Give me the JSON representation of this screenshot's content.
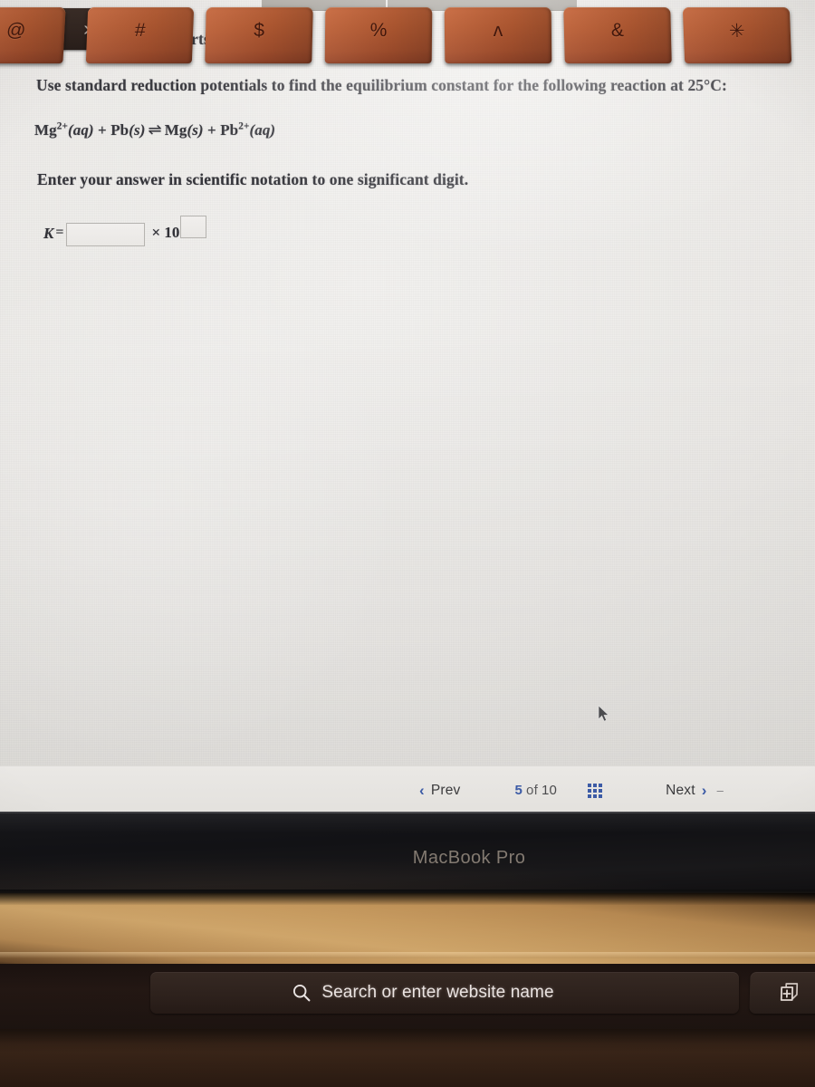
{
  "question": {
    "instruction": "Be sure to answer all parts.",
    "prompt": "Use standard reduction potentials to find the equilibrium constant for the following reaction at 25°C:",
    "equation": {
      "reactant_1_symbol": "Mg",
      "reactant_1_charge": "2+",
      "reactant_1_state": "(aq)",
      "plus_1": "+",
      "reactant_2_symbol": "Pb",
      "reactant_2_state": "(s)",
      "arrow": "⇌",
      "product_1_symbol": "Mg",
      "product_1_state": "(s)",
      "plus_2": "+",
      "product_2_symbol": "Pb",
      "product_2_charge": "2+",
      "product_2_state": "(aq)",
      "plain_text": "Mg2+(aq) + Pb(s) ⇌ Mg(s) + Pb2+(aq)"
    },
    "answer_instruction": "Enter your answer in scientific notation to one significant digit."
  },
  "answer": {
    "k_label": "K",
    "equals": "=",
    "coefficient_value": "",
    "coefficient_placeholder": "",
    "times_ten": "× 10",
    "exponent_value": "",
    "exponent_placeholder": ""
  },
  "navigation": {
    "prev_label": "Prev",
    "prev_chevron": "‹",
    "current_page": "5",
    "of_label": "of",
    "total_pages": "10",
    "grid_icon": "grid-icon",
    "next_label": "Next",
    "next_chevron": "›",
    "trailing_mark": "–",
    "accent_color": "#3c5ba6"
  },
  "laptop": {
    "brand_label": "MacBook Pro"
  },
  "touchbar": {
    "escape_glyph": "↖",
    "forward_glyph": "›",
    "search_icon": "search-icon",
    "address_placeholder": "Search or enter website name",
    "newtab_icon": "new-tab-icon"
  },
  "keyboard": {
    "keys": [
      {
        "glyph": "@",
        "name": "key-at"
      },
      {
        "glyph": "#",
        "name": "key-hash"
      },
      {
        "glyph": "$",
        "name": "key-dollar"
      },
      {
        "glyph": "%",
        "name": "key-percent"
      },
      {
        "glyph": "ʌ",
        "name": "key-caret"
      },
      {
        "glyph": "&",
        "name": "key-ampersand"
      },
      {
        "glyph": "✳",
        "name": "key-asterisk"
      }
    ]
  },
  "colors": {
    "screen_background": "#eceae7",
    "text": "#2b2b31",
    "accent_blue": "#3c5ba6",
    "bezel": "#16161a",
    "body_band": "#c79b60",
    "key_face": "#bd5f35"
  }
}
